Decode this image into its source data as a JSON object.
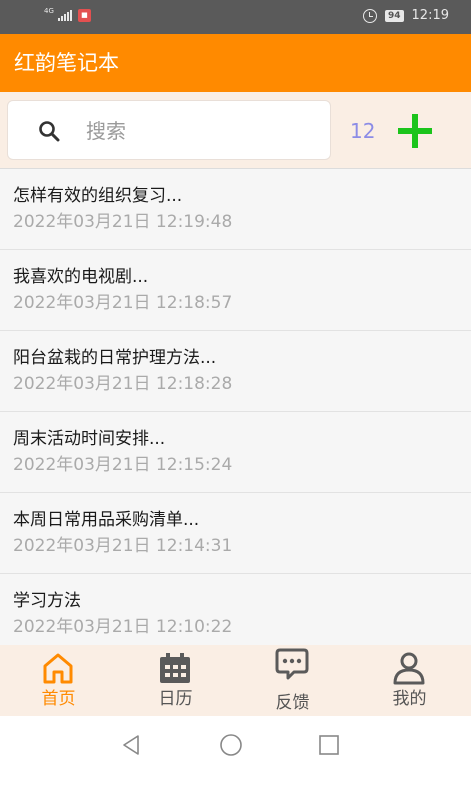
{
  "status_bar": {
    "network": "4G",
    "time": "12:19",
    "battery": "94",
    "icons": [
      "signal-icon",
      "app-notification-icon",
      "alarm-icon",
      "battery-icon"
    ]
  },
  "app_bar": {
    "title": "红韵笔记本",
    "color": "#ff8a00"
  },
  "search": {
    "placeholder": "搜索",
    "icon": "search-icon"
  },
  "note_count": "12",
  "add_button": {
    "icon": "plus-icon",
    "color": "#1bc41b"
  },
  "notes": [
    {
      "title": "怎样有效的组织复习...",
      "time": "2022年03月21日 12:19:48"
    },
    {
      "title": "我喜欢的电视剧...",
      "time": "2022年03月21日 12:18:57"
    },
    {
      "title": "阳台盆栽的日常护理方法...",
      "time": "2022年03月21日 12:18:28"
    },
    {
      "title": "周末活动时间安排...",
      "time": "2022年03月21日 12:15:24"
    },
    {
      "title": "本周日常用品采购清单...",
      "time": "2022年03月21日 12:14:31"
    },
    {
      "title": "学习方法",
      "time": "2022年03月21日 12:10:22"
    }
  ],
  "bottom_nav": {
    "items": [
      {
        "label": "首页",
        "icon": "home-icon",
        "active": true
      },
      {
        "label": "日历",
        "icon": "calendar-icon",
        "active": false
      },
      {
        "label": "反馈",
        "icon": "chat-icon",
        "active": false
      },
      {
        "label": "我的",
        "icon": "profile-icon",
        "active": false
      }
    ],
    "active_color": "#ff8a00",
    "inactive_color": "#555555"
  },
  "system_nav": {
    "icons": [
      "back-icon",
      "home-circle-icon",
      "recents-icon"
    ]
  }
}
